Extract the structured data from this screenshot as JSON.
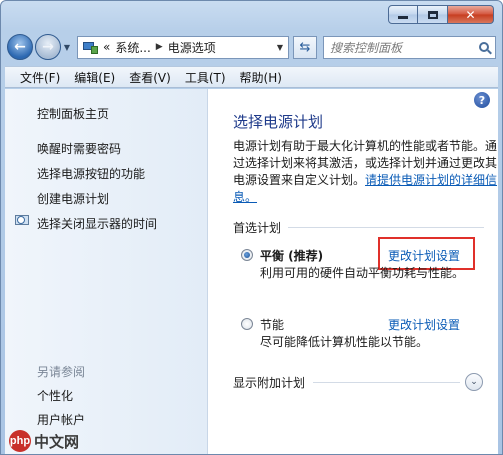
{
  "address": {
    "crumbs": [
      "«",
      "系统...",
      "电源选项"
    ],
    "search_placeholder": "搜索控制面板"
  },
  "menu": [
    "文件(F)",
    "编辑(E)",
    "查看(V)",
    "工具(T)",
    "帮助(H)"
  ],
  "left_pane": {
    "home": "控制面板主页",
    "links": [
      "唤醒时需要密码",
      "选择电源按钮的功能",
      "创建电源计划",
      "选择关闭显示器的时间"
    ],
    "see_also_heading": "另请参阅",
    "see_also": [
      "个性化",
      "用户帐户"
    ]
  },
  "main": {
    "title": "选择电源计划",
    "description": "电源计划有助于最大化计算机的性能或者节能。通过选择计划来将其激活，或选择计划并通过更改其电源设置来自定义计划。",
    "description_link": "请提供电源计划的详细信息。",
    "preferred_heading": "首选计划",
    "plans": [
      {
        "name": "平衡 (推荐)",
        "selected": true,
        "description": "利用可用的硬件自动平衡功耗与性能。",
        "link": "更改计划设置"
      },
      {
        "name": "节能",
        "selected": false,
        "description": "尽可能降低计算机性能以节能。",
        "link": "更改计划设置"
      }
    ],
    "additional_heading": "显示附加计划"
  },
  "watermark": {
    "logo": "php",
    "text": "中文网"
  },
  "colors": {
    "link": "#0a5bb6",
    "title": "#1e3a8a",
    "highlight": "#e0302a"
  }
}
